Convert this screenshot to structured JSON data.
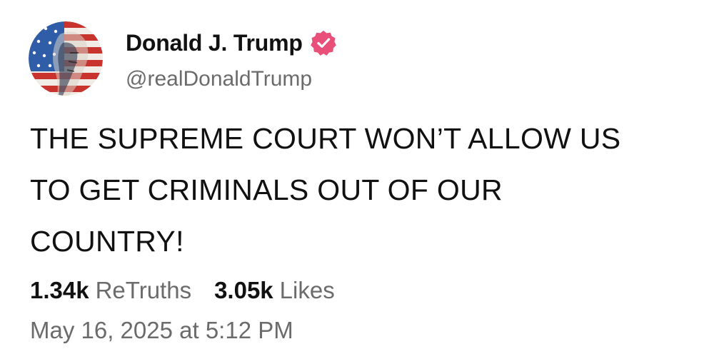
{
  "author": {
    "display_name": "Donald J. Trump",
    "handle": "@realDonaldTrump",
    "avatar_icon": "flag-portrait-avatar",
    "verified_badge_icon": "verified-badge-icon",
    "verified_badge_color": "#e8507a"
  },
  "post": {
    "lines": [
      "THE SUPREME COURT WON’T ALLOW US",
      "TO GET CRIMINALS OUT OF OUR",
      "COUNTRY!"
    ]
  },
  "stats": {
    "retruths_count": "1.34k",
    "retruths_label": "ReTruths",
    "likes_count": "3.05k",
    "likes_label": "Likes"
  },
  "timestamp": "May 16, 2025 at 5:12 PM",
  "colors": {
    "text_primary": "#111111",
    "text_secondary": "#6b6b6b",
    "background": "#ffffff"
  }
}
